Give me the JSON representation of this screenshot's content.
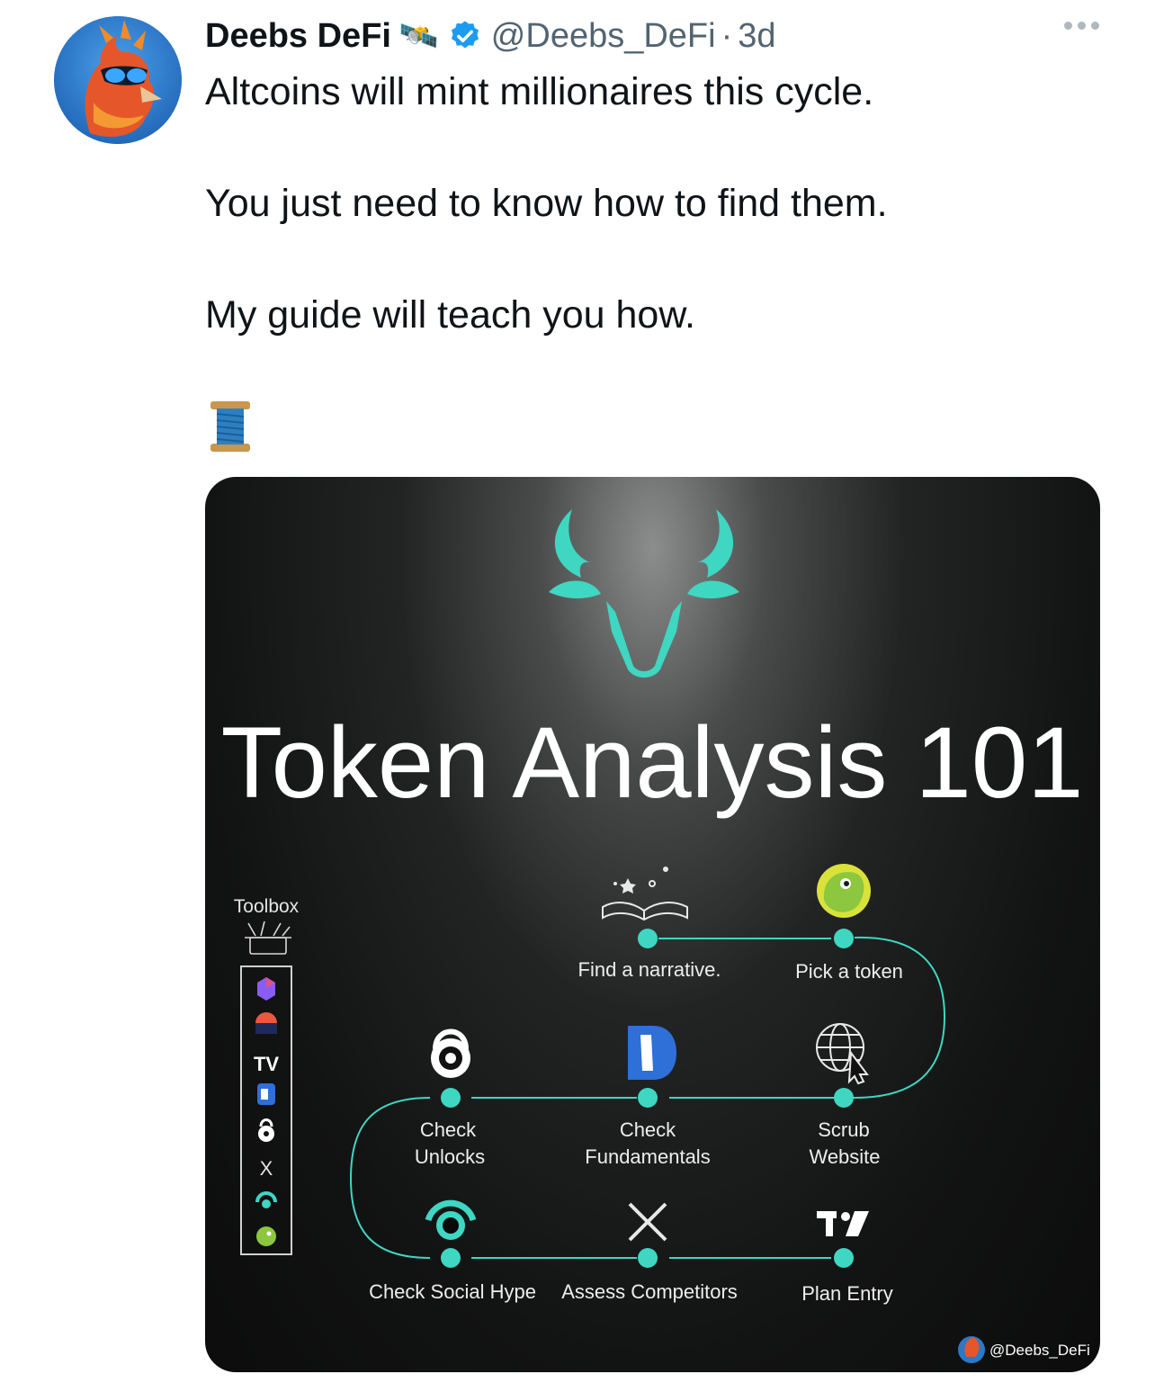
{
  "tweet": {
    "author_name": "Deebs DeFi",
    "handle": "@Deebs_DeFi",
    "separator": "·",
    "timestamp": "3d",
    "lines": [
      "Altcoins will mint millionaires this cycle.",
      "You just need to know how to find them.",
      "My guide will teach you how."
    ],
    "emoji": "🧵",
    "author_emoji": "🛰️"
  },
  "infographic": {
    "title": "Token Analysis 101",
    "toolbox_label": "Toolbox",
    "steps": [
      "Find a narrative.",
      "Pick a token",
      "Scrub Website",
      "Check Fundamentals",
      "Check Unlocks",
      "Check Social Hype",
      "Assess Competitors",
      "Plan Entry"
    ],
    "step_lines": {
      "scrub": [
        "Scrub",
        "Website"
      ],
      "fundamentals": [
        "Check",
        "Fundamentals"
      ],
      "unlocks": [
        "Check",
        "Unlocks"
      ]
    },
    "watermark": "@Deebs_DeFi",
    "accent_color": "#3fd6c2",
    "icons": [
      "open-book-icon",
      "coingecko-icon",
      "globe-cursor-icon",
      "defillama-icon",
      "lock-icon",
      "lunarcrush-icon",
      "x-logo-icon",
      "tradingview-icon"
    ]
  }
}
